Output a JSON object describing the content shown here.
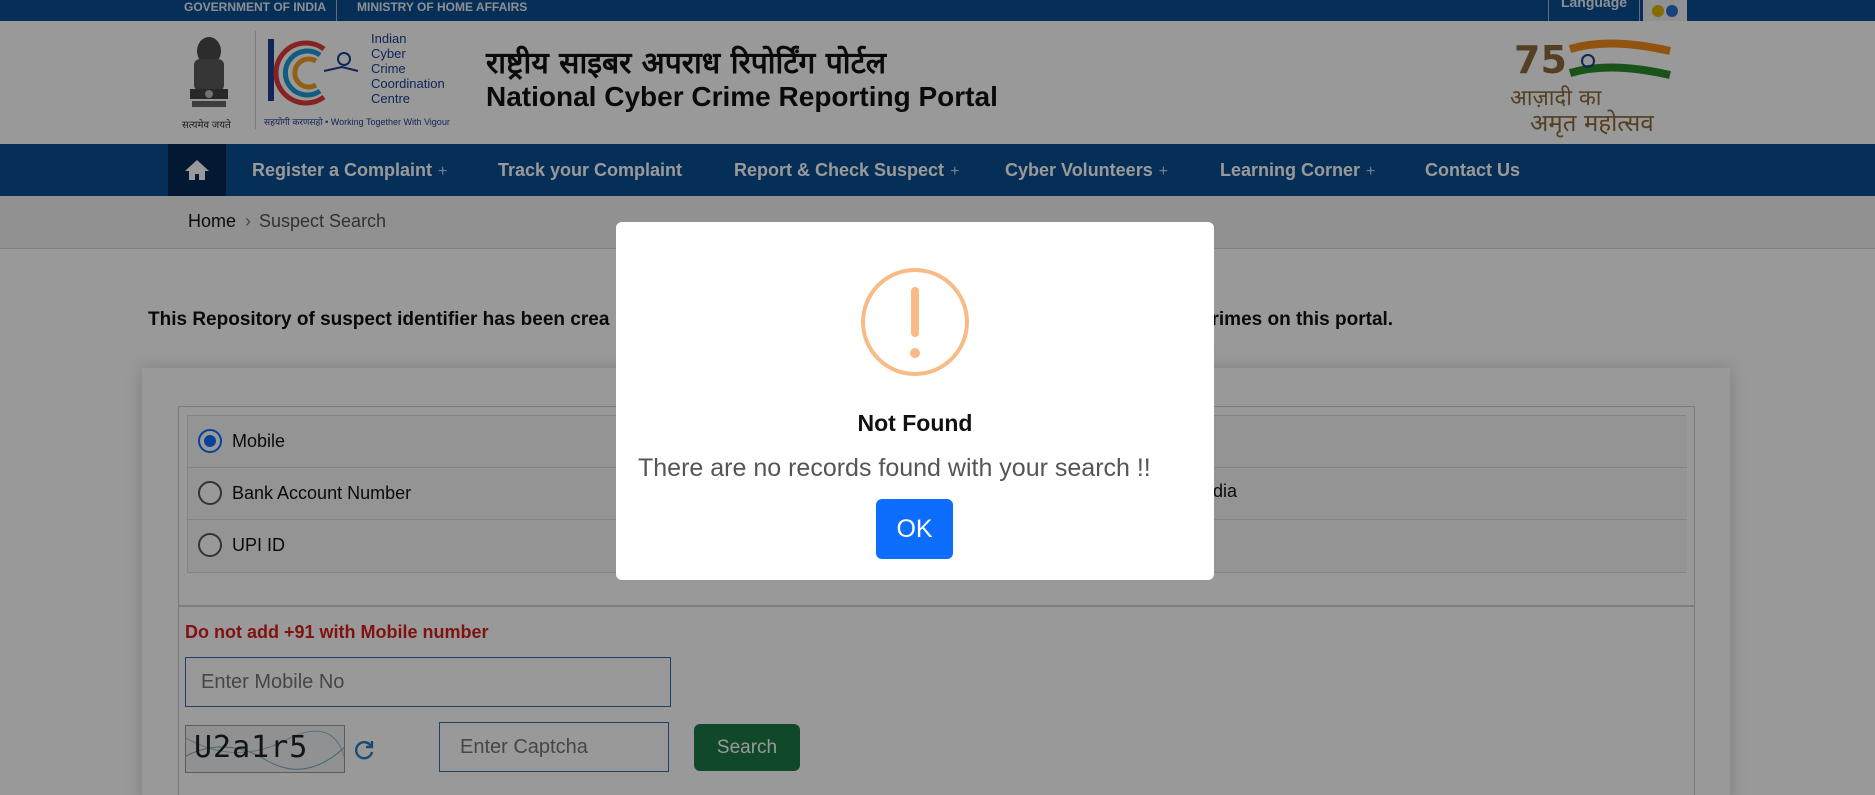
{
  "topbar": {
    "gov_label": "GOVERNMENT OF INDIA",
    "ministry_label": "MINISTRY OF HOME AFFAIRS",
    "language_label": "Language"
  },
  "header": {
    "emblem_caption": "सत्यमेव जयते",
    "i4c_lines": [
      "Indian",
      "Cyber",
      "Crime",
      "Coordination",
      "Centre"
    ],
    "i4c_tagline": "सहयोगी करणसहो  •  Working Together With Vigour",
    "title_hindi": "राष्ट्रीय साइबर अपराध रिपोर्टिंग पोर्टल",
    "title_english": "National Cyber Crime Reporting Portal",
    "azadi_line1": "आज़ादी का",
    "azadi_line2": "अमृत महोत्सव"
  },
  "nav": {
    "items": [
      {
        "label": "Register a Complaint",
        "plus": "+"
      },
      {
        "label": "Track your Complaint",
        "plus": ""
      },
      {
        "label": "Report & Check Suspect",
        "plus": "+"
      },
      {
        "label": "Cyber Volunteers",
        "plus": "+"
      },
      {
        "label": "Learning Corner",
        "plus": "+"
      },
      {
        "label": "Contact Us",
        "plus": ""
      }
    ]
  },
  "breadcrumb": {
    "home": "Home",
    "current": "Suspect Search"
  },
  "intro_text_left": "This Repository of suspect identifier has been crea",
  "intro_text_right": "ercrimes on this portal.",
  "search_options": {
    "mobile": "Mobile",
    "bank": "Bank Account Number",
    "upi": "UPI ID",
    "social_partial": "edia",
    "selected": "Mobile"
  },
  "form": {
    "warning": "Do not add +91 with Mobile number",
    "mobile_placeholder": "Enter Mobile No",
    "captcha_text": "U2a1r5",
    "captcha_placeholder": "Enter Captcha",
    "search_label": "Search"
  },
  "modal": {
    "title": "Not Found",
    "message": "There are no records found with your search !!",
    "ok_label": "OK"
  },
  "colors": {
    "primary_blue": "#0a4f93",
    "nav_home_bg": "#052a55",
    "ok_button": "#0d6efd",
    "search_button": "#1a7a45",
    "warning_text": "#d61f1f",
    "warning_icon": "#f8bb86"
  }
}
